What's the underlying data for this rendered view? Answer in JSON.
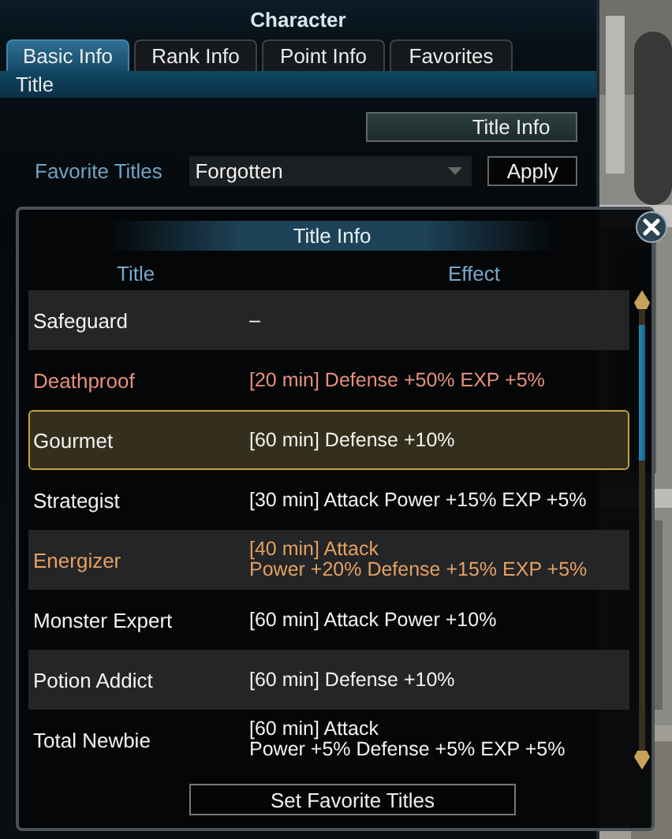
{
  "window": {
    "title": "Character"
  },
  "tabs": [
    {
      "label": "Basic Info",
      "selected": true
    },
    {
      "label": "Rank Info",
      "selected": false
    },
    {
      "label": "Point Info",
      "selected": false
    },
    {
      "label": "Favorites",
      "selected": false
    }
  ],
  "section": {
    "title": "Title"
  },
  "title_info_button": "Title Info",
  "favorite": {
    "label": "Favorite Titles",
    "value": "Forgotten",
    "apply": "Apply"
  },
  "popup": {
    "title": "Title Info",
    "columns": [
      "Title",
      "Effect"
    ],
    "rows": [
      {
        "title": "Safeguard",
        "effect": [
          "–"
        ],
        "kind": "plain",
        "selected": false
      },
      {
        "title": "Deathproof",
        "effect": [
          "[20 min] Defense +50% EXP +5%"
        ],
        "kind": "accent",
        "selected": false
      },
      {
        "title": "Gourmet",
        "effect": [
          "[60 min] Defense +10%"
        ],
        "kind": "plain",
        "selected": true
      },
      {
        "title": "Strategist",
        "effect": [
          "[30 min] Attack Power +15% EXP +5%"
        ],
        "kind": "plain",
        "selected": false
      },
      {
        "title": "Energizer",
        "effect": [
          "[40 min] Attack",
          "Power +20% Defense +15% EXP +5%"
        ],
        "kind": "highlight",
        "selected": false
      },
      {
        "title": "Monster Expert",
        "effect": [
          "[60 min] Attack Power +10%"
        ],
        "kind": "plain",
        "selected": false
      },
      {
        "title": "Potion Addict",
        "effect": [
          "[60 min] Defense +10%"
        ],
        "kind": "plain",
        "selected": false
      },
      {
        "title": "Total Newbie",
        "effect": [
          "[60 min] Attack",
          "Power +5% Defense +5% EXP +5%"
        ],
        "kind": "plain",
        "selected": false
      }
    ],
    "button": "Set Favorite Titles"
  }
}
